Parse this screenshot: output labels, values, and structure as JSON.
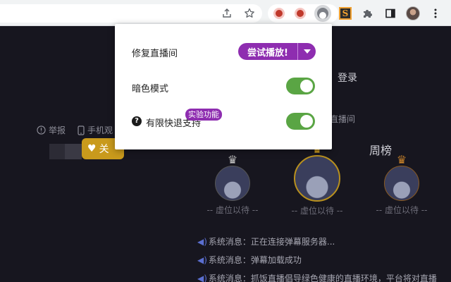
{
  "browser": {
    "toolbar_icons": [
      "share-icon",
      "star-icon",
      "puzzle-icon",
      "side-panel-icon",
      "kebab-menu-icon"
    ],
    "extensions": [
      "red-extension-icon",
      "red-extension-icon",
      "active-extension-icon",
      "s-extension-icon"
    ],
    "s_extension_letter": "S"
  },
  "page": {
    "login": "登录",
    "report": "举报",
    "phone_watch": "手机观",
    "live_room": "直播间",
    "follow_button": "关",
    "weekly_board": "周榜",
    "rank_vacant": "-- 虚位以待 --",
    "system_messages": [
      "系统消息：正在连接弹幕服务器...",
      "系统消息：弹幕加载成功",
      "系统消息：抓饭直播倡导绿色健康的直播环境，平台将对直播"
    ],
    "colors": {
      "gold": "#c99a1c",
      "silver": "#c0c0c0",
      "bronze": "#c8822a"
    }
  },
  "popup": {
    "repair_label": "修复直播间",
    "try_play_button": "尝试播放!",
    "dark_mode_label": "暗色模式",
    "dark_mode_on": true,
    "limited_fast_back_label": "有限快退支持",
    "limited_fast_back_on": true,
    "experimental_badge": "实验功能",
    "help_glyph": "?",
    "colors": {
      "accent": "#8e2db0",
      "toggle_on": "#5aa544"
    }
  }
}
